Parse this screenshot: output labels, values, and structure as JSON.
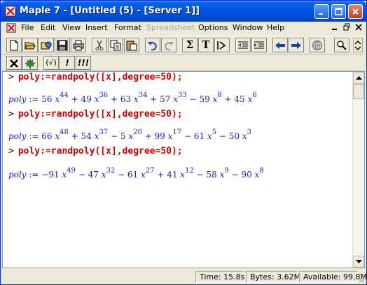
{
  "window": {
    "title": "Maple 7 - [Untitled (5) - [Server 1]]"
  },
  "menubar": {
    "items": [
      "File",
      "Edit",
      "View",
      "Insert",
      "Format",
      "Spreadsheet",
      "Options",
      "Window",
      "Help"
    ],
    "disabled_item": "Spreadsheet"
  },
  "context_toolbar": {
    "buttons": [
      "(√)",
      "!",
      "!!!"
    ]
  },
  "worksheet": {
    "prompt": ">",
    "groups": [
      {
        "command": "poly:=randpoly([x],degree=50);",
        "output": {
          "lhs": "poly",
          "assign": ":=",
          "terms": [
            {
              "sign": "",
              "coef": "56",
              "var": "x",
              "exp": "44"
            },
            {
              "sign": "+",
              "coef": "49",
              "var": "x",
              "exp": "36"
            },
            {
              "sign": "+",
              "coef": "63",
              "var": "x",
              "exp": "34"
            },
            {
              "sign": "+",
              "coef": "57",
              "var": "x",
              "exp": "33"
            },
            {
              "sign": "−",
              "coef": "59",
              "var": "x",
              "exp": "8"
            },
            {
              "sign": "+",
              "coef": "45",
              "var": "x",
              "exp": "6"
            }
          ]
        }
      },
      {
        "command": "poly:=randpoly([x],degree=50);",
        "output": {
          "lhs": "poly",
          "assign": ":=",
          "terms": [
            {
              "sign": "",
              "coef": "66",
              "var": "x",
              "exp": "48"
            },
            {
              "sign": "+",
              "coef": "54",
              "var": "x",
              "exp": "37"
            },
            {
              "sign": "−",
              "coef": "5",
              "var": "x",
              "exp": "20"
            },
            {
              "sign": "+",
              "coef": "99",
              "var": "x",
              "exp": "17"
            },
            {
              "sign": "−",
              "coef": "61",
              "var": "x",
              "exp": "5"
            },
            {
              "sign": "−",
              "coef": "50",
              "var": "x",
              "exp": "3"
            }
          ]
        }
      },
      {
        "command": "poly:=randpoly([x],degree=50);",
        "output": {
          "lhs": "poly",
          "assign": ":=",
          "terms": [
            {
              "sign": "−",
              "coef": "91",
              "var": "x",
              "exp": "49"
            },
            {
              "sign": "−",
              "coef": "47",
              "var": "x",
              "exp": "32"
            },
            {
              "sign": "−",
              "coef": "61",
              "var": "x",
              "exp": "27"
            },
            {
              "sign": "+",
              "coef": "41",
              "var": "x",
              "exp": "12"
            },
            {
              "sign": "−",
              "coef": "58",
              "var": "x",
              "exp": "9"
            },
            {
              "sign": "−",
              "coef": "90",
              "var": "x",
              "exp": "8"
            }
          ]
        }
      }
    ]
  },
  "statusbar": {
    "time": "Time: 15.8s",
    "bytes": "Bytes: 3.62M",
    "available": "Available: 99.8M"
  },
  "colors": {
    "command": "#cc0000",
    "output": "#1818cc",
    "titlebar": "#0054e3"
  }
}
